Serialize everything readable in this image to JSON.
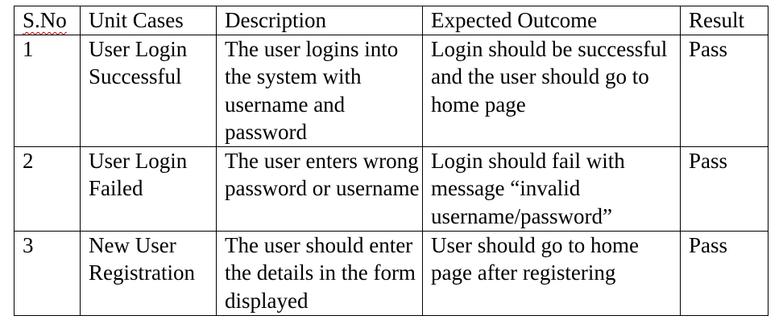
{
  "table": {
    "headers": [
      "S.No",
      "Unit Cases",
      "Description",
      "Expected Outcome",
      "Result"
    ],
    "rows": [
      {
        "sno": "1",
        "unit_case": "User Login Successful",
        "description": "The user logins into the system with username and password",
        "expected": "Login should be successful and the user should go to home page",
        "result": "Pass"
      },
      {
        "sno": "2",
        "unit_case": "User Login Failed",
        "description": "The user enters wrong password or username",
        "expected": "Login should fail with message “invalid username/password”",
        "result": "Pass"
      },
      {
        "sno": "3",
        "unit_case": "New User Registration",
        "description": "The user should enter the details in the form displayed",
        "expected": "User should go to home page after registering",
        "result": "Pass"
      }
    ]
  }
}
